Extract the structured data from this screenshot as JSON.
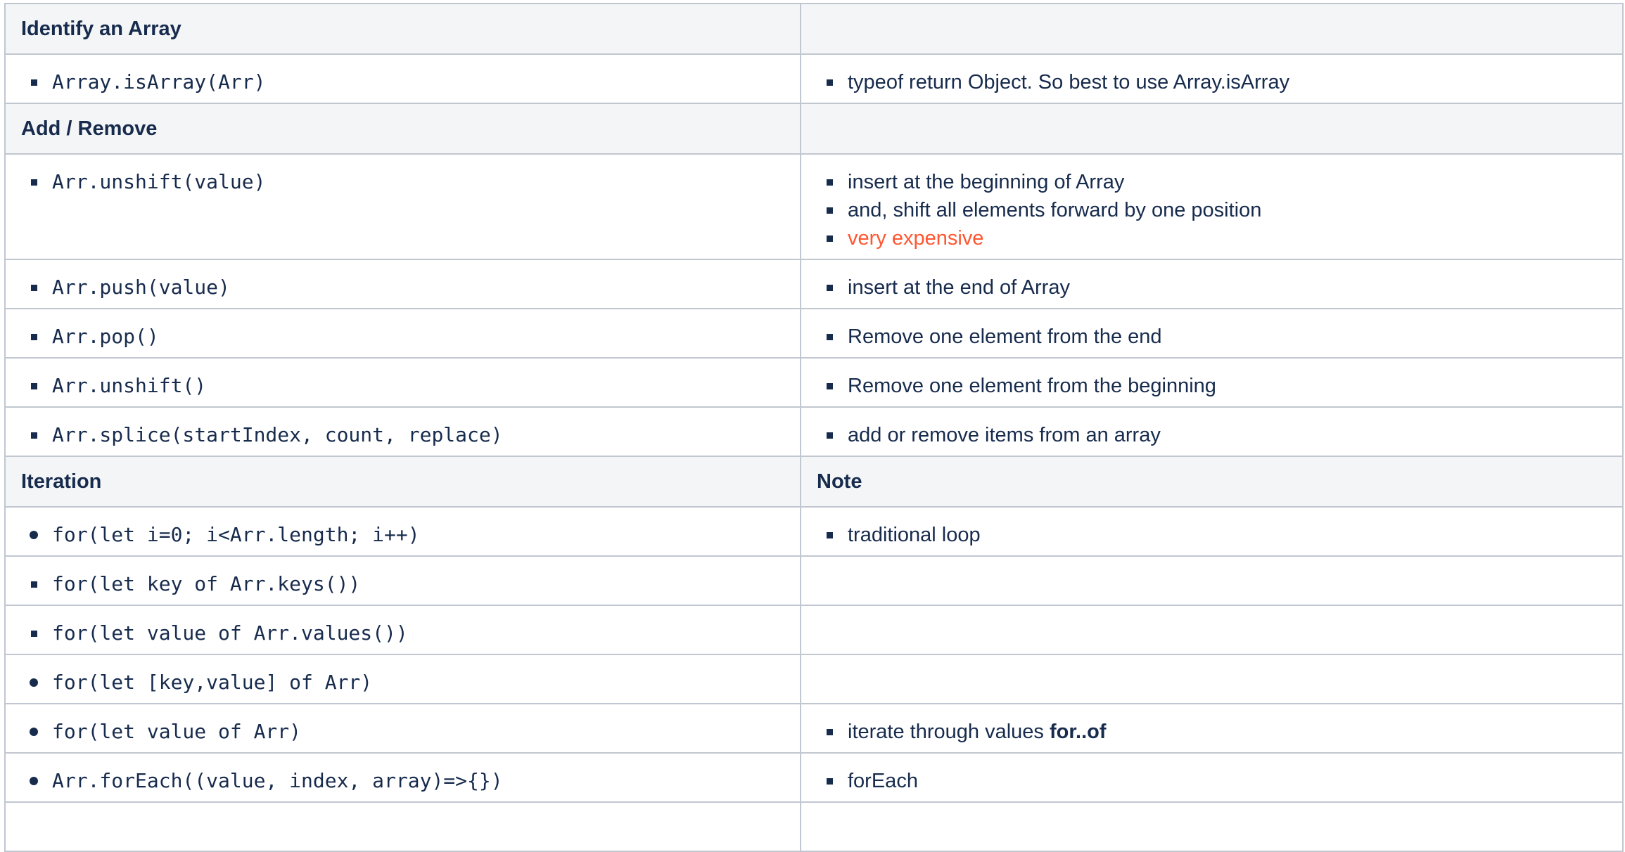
{
  "sections": [
    {
      "header": {
        "left": "Identify an Array",
        "right": ""
      },
      "rows": [
        {
          "method": "Array.isArray(Arr)",
          "bullet": "square",
          "notes": [
            {
              "text": "typeof return Object. So best to use Array.isArray"
            }
          ]
        }
      ]
    },
    {
      "header": {
        "left": "Add / Remove",
        "right": ""
      },
      "rows": [
        {
          "method": "Arr.unshift(value)",
          "bullet": "square",
          "notes": [
            {
              "text": "insert at the beginning of Array"
            },
            {
              "text": "and, shift all elements forward by one position"
            },
            {
              "text": "very expensive",
              "color": "#ff5630"
            }
          ]
        },
        {
          "method": "Arr.push(value)",
          "bullet": "square",
          "notes": [
            {
              "text": "insert at the end of Array"
            }
          ]
        },
        {
          "method": "Arr.pop()",
          "bullet": "square",
          "notes": [
            {
              "text": "Remove one element from the end"
            }
          ]
        },
        {
          "method": "Arr.unshift()",
          "bullet": "square",
          "notes": [
            {
              "text": "Remove one element from the beginning"
            }
          ]
        },
        {
          "method": "Arr.splice(startIndex, count, replace)",
          "bullet": "square",
          "notes": [
            {
              "text": "add or remove items from an array"
            }
          ]
        }
      ]
    },
    {
      "header": {
        "left": "Iteration",
        "right": "Note"
      },
      "rows": [
        {
          "method": "for(let i=0; i<Arr.length; i++)",
          "bullet": "disc",
          "notes": [
            {
              "text": "traditional loop"
            }
          ]
        },
        {
          "method": "for(let key of Arr.keys())",
          "bullet": "square",
          "notes": []
        },
        {
          "method": "for(let value of Arr.values())",
          "bullet": "square",
          "notes": []
        },
        {
          "method": "for(let [key,value] of Arr)",
          "bullet": "disc",
          "notes": []
        },
        {
          "method": "for(let value of Arr)",
          "bullet": "disc",
          "notes": [
            {
              "text": "iterate through values ",
              "bold": "for..of"
            }
          ]
        },
        {
          "method": "Arr.forEach((value, index, array)=>{})",
          "bullet": "disc",
          "notes": [
            {
              "text": "forEach"
            }
          ]
        }
      ]
    }
  ]
}
